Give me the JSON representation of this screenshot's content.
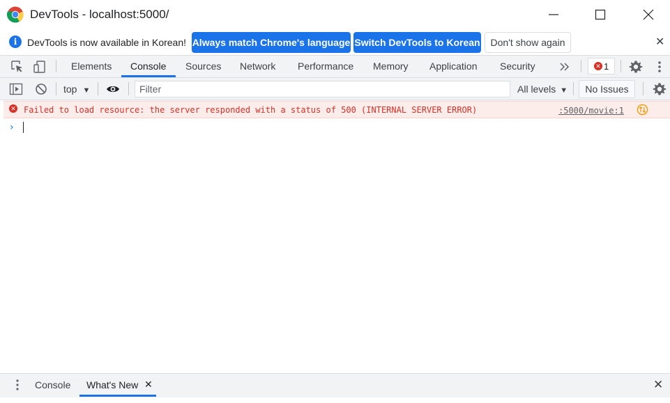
{
  "window": {
    "title": "DevTools - localhost:5000/"
  },
  "infobar": {
    "message": "DevTools is now available in Korean!",
    "match_language_label": "Always match Chrome's language",
    "switch_language_label": "Switch DevTools to Korean",
    "dont_show_label": "Don't show again"
  },
  "tabs": [
    {
      "label": "Elements"
    },
    {
      "label": "Console",
      "active": true
    },
    {
      "label": "Sources"
    },
    {
      "label": "Network"
    },
    {
      "label": "Performance"
    },
    {
      "label": "Memory"
    },
    {
      "label": "Application"
    },
    {
      "label": "Security"
    }
  ],
  "error_badge": {
    "count": "1"
  },
  "console_toolbar": {
    "context": "top",
    "filter_placeholder": "Filter",
    "levels": "All levels",
    "issues": "No Issues"
  },
  "console": {
    "messages": [
      {
        "level": "error",
        "text": "Failed to load resource: the server responded with a status of 500 (INTERNAL SERVER ERROR)",
        "source": ":5000/movie:1"
      }
    ]
  },
  "drawer": {
    "tabs": [
      {
        "label": "Console"
      },
      {
        "label": "What's New",
        "active": true
      }
    ]
  },
  "colors": {
    "accent": "#1a73e8",
    "error": "#d93025",
    "error_bg": "#fcecea",
    "toolbar_bg": "#f1f3f4"
  }
}
